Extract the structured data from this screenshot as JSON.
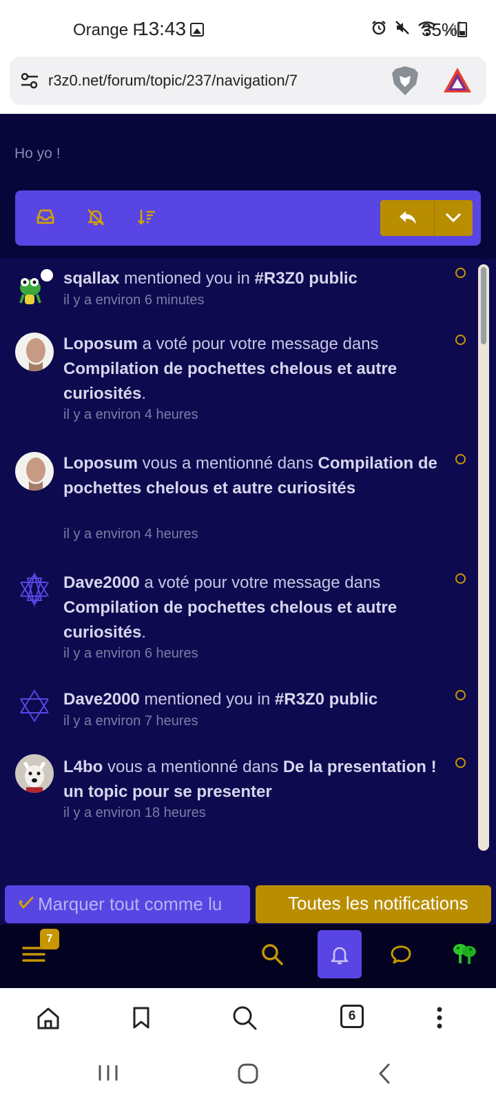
{
  "status_bar": {
    "carrier": "Orange F",
    "time": "13:43",
    "battery": "35%"
  },
  "browser": {
    "url": "r3z0.net/forum/topic/237/navigation/7",
    "tab_count": "6"
  },
  "forum": {
    "snippet": "Ho yo !",
    "accent": "#5845e3",
    "gold": "#b98d00"
  },
  "notifications": [
    {
      "user": "sqallax",
      "action": " mentioned you in ",
      "target": "#R3Z0 public",
      "target_is_hashtag": true,
      "suffix": "",
      "time": "il y a environ 6 minutes",
      "avatar": "frog-avatar"
    },
    {
      "user": "Loposum",
      "action": " a voté pour votre message dans ",
      "target": "Compilation de pochettes chelous et autre curiosités",
      "target_is_hashtag": false,
      "suffix": ".",
      "time": "il y a environ 4 heures",
      "avatar": "bald-man-avatar"
    },
    {
      "user": "Loposum",
      "action": " vous a mentionné dans ",
      "target": "Compilation de pochettes chelous et autre curiosités",
      "target_is_hashtag": false,
      "suffix": "",
      "time": "il y a environ 4 heures",
      "avatar": "bald-man-avatar"
    },
    {
      "user": "Dave2000",
      "action": " a voté pour votre message dans ",
      "target": "Compilation de pochettes chelous et autre curiosités",
      "target_is_hashtag": false,
      "suffix": ".",
      "time": "il y a environ 6 heures",
      "avatar": "star-emblem-avatar"
    },
    {
      "user": "Dave2000",
      "action": " mentioned you in ",
      "target": "#R3Z0 public",
      "target_is_hashtag": true,
      "suffix": "",
      "time": "il y a environ 7 heures",
      "avatar": "star-emblem-avatar"
    },
    {
      "user": "L4bo",
      "action": " vous a mentionné dans ",
      "target": "De la presentation ! un topic pour se presenter",
      "target_is_hashtag": false,
      "suffix": "",
      "time": "il y a environ 18 heures",
      "avatar": "dog-avatar"
    }
  ],
  "actions": {
    "mark_all_read": "Marquer tout comme lu",
    "all_notifications": "Toutes les notifications"
  },
  "forum_nav": {
    "menu_badge": "7"
  }
}
